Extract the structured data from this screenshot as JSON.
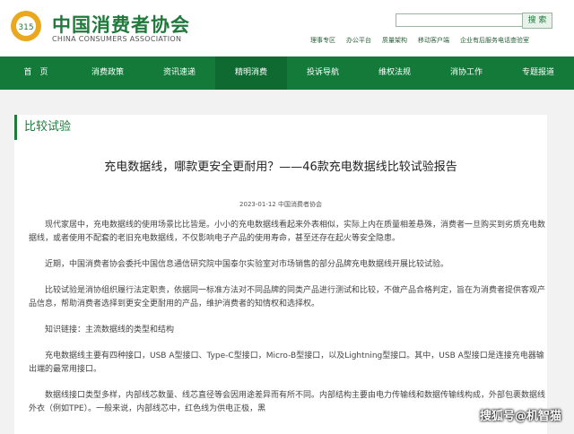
{
  "brand": {
    "name_cn": "中国消费者协会",
    "name_en": "CHINA CONSUMERS ASSOCIATION"
  },
  "search": {
    "placeholder": "",
    "button_label": "搜 索"
  },
  "top_links": [
    "理事专区",
    "办公平台",
    "质量架构",
    "移动客户端",
    "企业有后服务电话查验室"
  ],
  "nav": [
    "首　页",
    "消费政策",
    "资讯速递",
    "精明消费",
    "投诉导航",
    "维权法规",
    "消协工作",
    "专题报道"
  ],
  "section_title": "比较试验",
  "article": {
    "title": "充电数据线，哪款更安全更耐用？——46款充电数据线比较试验报告",
    "meta": "2023-01-12 中国消费者协会",
    "paragraphs": [
      "现代家居中，充电数据线的使用场景比比皆是。小小的充电数据线看起来外表相似，实际上内在质量相差悬殊，消费者一旦购买到劣质充电数据线，或者使用不配套的老旧充电数据线，不仅影响电子产品的使用寿命，甚至还存在起火等安全隐患。",
      "近期，中国消费者协会委托中国信息通信研究院中国泰尔实验室对市场销售的部分品牌充电数据线开展比较试验。",
      "比较试验是消协组织履行法定职责，依据同一标准方法对不同品牌的同类产品进行测试和比较，不做产品合格判定，旨在为消费者提供客观产品信息，帮助消费者选择到更安全更耐用的产品，维护消费者的知情权和选择权。",
      "知识链接：主流数据线的类型和结构",
      "充电数据线主要有四种接口，USB A型接口、Type-C型接口，Micro-B型接口，以及Lightning型接口。其中，USB A型接口是连接充电器输出端的最常用接口。",
      "数据线接口类型多样，内部线芯数量、线芯直径等会因用途差异而有所不同。内部结构主要由电力传输线和数据传输线构成，外部包裹数据线外衣（例如TPE）。一般来说，内部线芯中，红色线为供电正极，黑"
    ]
  },
  "watermark": "搜狐号@机智猫"
}
